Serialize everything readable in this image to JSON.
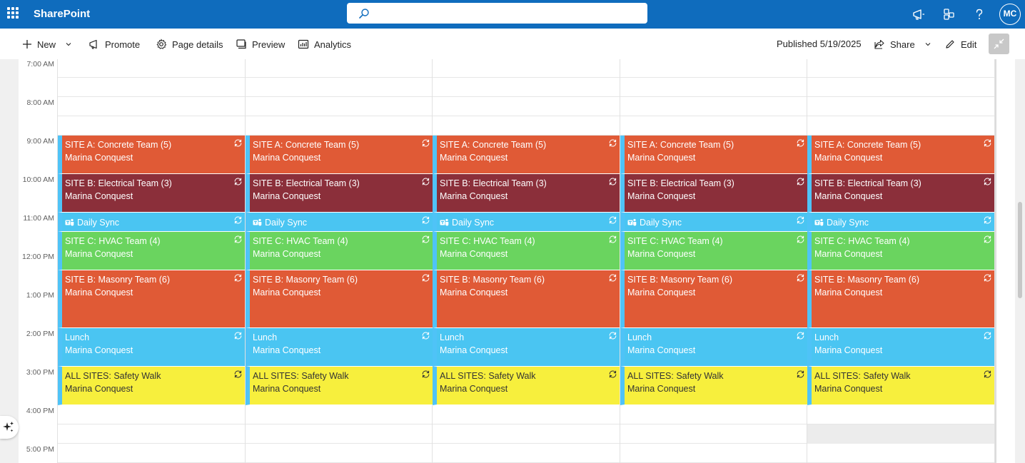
{
  "app": {
    "name": "SharePoint"
  },
  "user": {
    "initials": "MC"
  },
  "icons": {
    "app_launcher": "waffle-icon",
    "search": "search-icon",
    "feedback": "megaphone-icon",
    "apps": "apps-icon",
    "help": "help-icon",
    "recurring": "recurring-icon",
    "teams": "teams-icon",
    "copilot": "sparkle-icon"
  },
  "commandbar": {
    "new_label": "New",
    "promote_label": "Promote",
    "page_details_label": "Page details",
    "preview_label": "Preview",
    "analytics_label": "Analytics",
    "published_label": "Published 5/19/2025",
    "share_label": "Share",
    "edit_label": "Edit"
  },
  "calendar": {
    "time_labels": [
      "7:00 AM",
      "8:00 AM",
      "9:00 AM",
      "10:00 AM",
      "11:00 AM",
      "12:00 PM",
      "1:00 PM",
      "2:00 PM",
      "3:00 PM",
      "4:00 PM",
      "5:00 PM"
    ],
    "day_columns": 5,
    "events": [
      {
        "title": "SITE A: Concrete Team (5)",
        "organizer": "Marina Conquest",
        "start": "9:00 AM",
        "end": "10:00 AM",
        "color": "#e05a36",
        "text_color": "#ffffff",
        "recurring": true,
        "teams": false
      },
      {
        "title": "SITE B: Electrical Team (3)",
        "organizer": "Marina Conquest",
        "start": "10:00 AM",
        "end": "11:00 AM",
        "color": "#8b2f3a",
        "text_color": "#ffffff",
        "recurring": true,
        "teams": false
      },
      {
        "title": "Daily Sync",
        "organizer": "",
        "start": "11:00 AM",
        "end": "11:30 AM",
        "color": "#4ac5f2",
        "text_color": "#ffffff",
        "recurring": true,
        "teams": true
      },
      {
        "title": "SITE C: HVAC Team (4)",
        "organizer": "Marina Conquest",
        "start": "11:30 AM",
        "end": "12:30 PM",
        "color": "#6ad45f",
        "text_color": "#ffffff",
        "recurring": true,
        "teams": false
      },
      {
        "title": "SITE B: Masonry Team (6)",
        "organizer": "Marina Conquest",
        "start": "12:30 PM",
        "end": "2:00 PM",
        "color": "#e05a36",
        "text_color": "#ffffff",
        "recurring": true,
        "teams": false
      },
      {
        "title": "Lunch",
        "organizer": "Marina Conquest",
        "start": "2:00 PM",
        "end": "3:00 PM",
        "color": "#4ac5f2",
        "text_color": "#ffffff",
        "recurring": true,
        "teams": false
      },
      {
        "title": "ALL SITES: Safety Walk",
        "organizer": "Marina Conquest",
        "start": "3:00 PM",
        "end": "4:00 PM",
        "color": "#f7ef3d",
        "text_color": "#333333",
        "recurring": true,
        "teams": false
      }
    ]
  }
}
